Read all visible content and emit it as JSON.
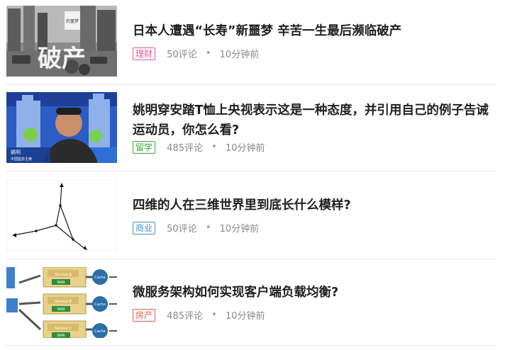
{
  "articles": [
    {
      "title": "日本人遭遇“长寿”新噩梦 辛苦一生最后濒临破产",
      "tag": "理财",
      "tag_color": "#e0569a",
      "comments": "50评论",
      "sep": "•",
      "time": "10分钟前",
      "thumb_text": {
        "big": "破产",
        "small": "的噩梦"
      }
    },
    {
      "title": "姚明穿安踏T恤上央视表示这是一种态度，并引用自己的例子告诫运动员，你怎么看?",
      "tag": "留学",
      "tag_color": "#3aaa35",
      "comments": "485评论",
      "sep": "•",
      "time": "10分钟前",
      "thumb_text": {
        "name": "姚明",
        "caption": "中国篮协主席"
      }
    },
    {
      "title": "四维的人在三维世界里到底长什么模样?",
      "tag": "商业",
      "tag_color": "#3d8fd0",
      "comments": "50评论",
      "sep": "•",
      "time": "10分钟前"
    },
    {
      "title": "微服务架构如何实现客户端负载均衡?",
      "tag": "房产",
      "tag_color": "#e25a4a",
      "comments": "485评论",
      "sep": "•",
      "time": "10分钟前",
      "thumb_text": {
        "services": [
          "Service A",
          "Service B",
          "Service C"
        ],
        "war": "WAR",
        "cache": "Cache"
      }
    }
  ]
}
